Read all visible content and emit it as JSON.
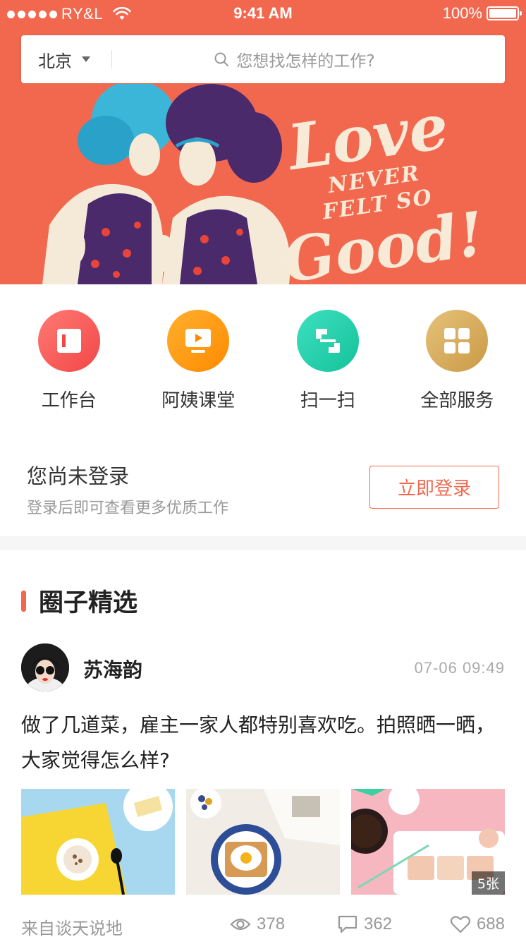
{
  "status_bar": {
    "carrier": "RY&L",
    "time": "9:41 AM",
    "battery": "100%"
  },
  "search": {
    "city": "北京",
    "placeholder": "您想找怎样的工作?"
  },
  "banner": {
    "line1": "Love",
    "line2": "NEVER",
    "line3": "FELT SO",
    "line4": "Good!"
  },
  "services": [
    {
      "label": "工作台",
      "icon": "workbench-icon",
      "color_from": "#ff7a74",
      "color_to": "#f24646"
    },
    {
      "label": "阿姨课堂",
      "icon": "classroom-icon",
      "color_from": "#ffb02e",
      "color_to": "#ff8a00"
    },
    {
      "label": "扫一扫",
      "icon": "scan-icon",
      "color_from": "#3ee0c0",
      "color_to": "#14c29a"
    },
    {
      "label": "全部服务",
      "icon": "all-services-icon",
      "color_from": "#e6c27a",
      "color_to": "#c99a45"
    }
  ],
  "login": {
    "title": "您尚未登录",
    "subtitle": "登录后即可查看更多优质工作",
    "button": "立即登录"
  },
  "feed": {
    "section_title": "圈子精选",
    "post": {
      "author": "苏海韵",
      "time": "07-06  09:49",
      "body": "做了几道菜，雇主一家人都特别喜欢吃。拍照晒一晒，大家觉得怎么样?",
      "image_count": "5张",
      "source": "来自谈天说地",
      "views": "378",
      "comments": "362",
      "likes": "688"
    }
  },
  "colors": {
    "brand": "#f2684f",
    "text": "#333333",
    "muted": "#999999"
  }
}
